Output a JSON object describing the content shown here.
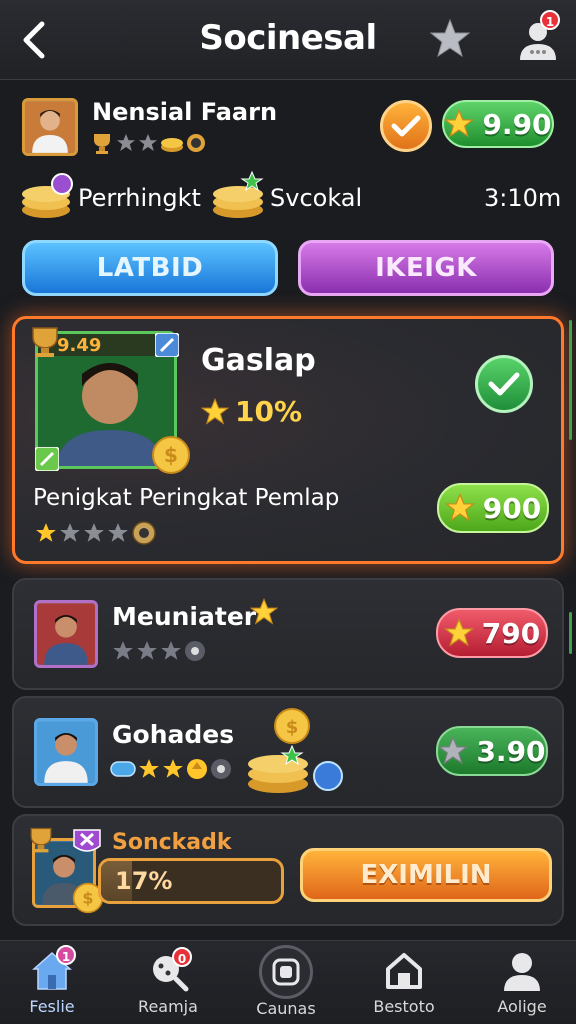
{
  "header": {
    "title": "Socinesal",
    "notification_count": "1"
  },
  "profile": {
    "name": "Nensial Faarn",
    "score": "9.90",
    "coin_label_1": "Perrhingkt",
    "coin_label_2": "Svcokal",
    "timer": "3:10m",
    "button_left": "LATBID",
    "button_right": "IKEIGK"
  },
  "featured_card": {
    "rank_badge": "9.49",
    "title": "Gaslap",
    "percent": "10%",
    "subtitle": "Penigkat Peringkat Pemlap",
    "score": "900"
  },
  "cards": [
    {
      "title": "Meuniater",
      "score": "790",
      "rating": 1
    },
    {
      "title": "Gohades",
      "score": "3.90",
      "rating": 3
    }
  ],
  "bottom_card": {
    "title": "Sonckadk",
    "progress_text": "17%",
    "progress": 0.17,
    "button": "EXIMILIN"
  },
  "nav": {
    "items": [
      {
        "label": "Feslie",
        "badge": "1"
      },
      {
        "label": "Reamja",
        "badge": "0"
      },
      {
        "label": "Caunas",
        "badge": ""
      },
      {
        "label": "Bestoto",
        "badge": ""
      },
      {
        "label": "Aolige",
        "badge": ""
      }
    ]
  },
  "colors": {
    "accent_orange": "#ff7a2a",
    "green": "#1f8f2e",
    "red": "#b61e33",
    "blue": "#1976d8",
    "purple": "#8a2fae",
    "gold": "#ffd34a"
  }
}
